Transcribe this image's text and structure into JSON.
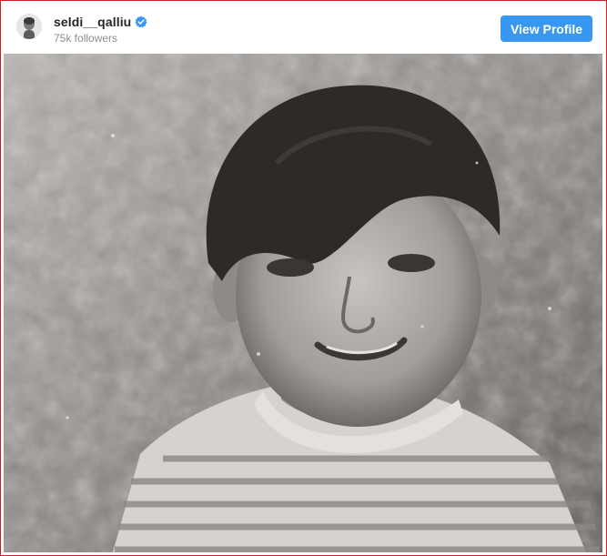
{
  "post_header": {
    "username": "seldi__qalliu",
    "followers_text": "75k followers",
    "view_profile_label": "View Profile",
    "verified_badge": "verified-badge-icon",
    "avatar": "profile-avatar"
  },
  "media": {
    "image": "black-and-white-photo",
    "description_icon": "photo"
  },
  "colors": {
    "button_bg": "#3897f0",
    "verified_blue": "#3897f0",
    "frame_border": "#c8202a",
    "muted_text": "#8e8e8e"
  }
}
